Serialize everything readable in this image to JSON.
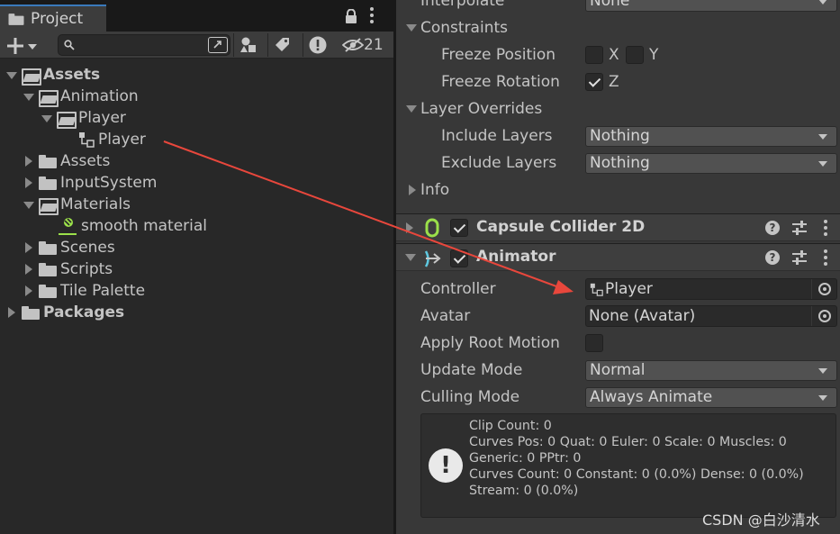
{
  "project": {
    "tab_label": "Project",
    "search": {
      "value": "",
      "placeholder": ""
    },
    "hidden_count": "21",
    "tree": [
      {
        "label": "Assets",
        "bold": true
      },
      {
        "label": "Animation"
      },
      {
        "label": "Player"
      },
      {
        "label": "Player"
      },
      {
        "label": "Assets"
      },
      {
        "label": "InputSystem"
      },
      {
        "label": "Materials"
      },
      {
        "label": "smooth material"
      },
      {
        "label": "Scenes"
      },
      {
        "label": "Scripts"
      },
      {
        "label": "Tile Palette"
      },
      {
        "label": "Packages",
        "bold": true
      }
    ]
  },
  "inspector": {
    "interpolate": {
      "label": "Interpolate",
      "value": "None"
    },
    "constraints": {
      "label": "Constraints"
    },
    "freeze_position": {
      "label": "Freeze Position",
      "x": "X",
      "y": "Y",
      "x_checked": false,
      "y_checked": false
    },
    "freeze_rotation": {
      "label": "Freeze Rotation",
      "z": "Z",
      "z_checked": true
    },
    "layer_overrides": {
      "label": "Layer Overrides"
    },
    "include_layers": {
      "label": "Include Layers",
      "value": "Nothing"
    },
    "exclude_layers": {
      "label": "Exclude Layers",
      "value": "Nothing"
    },
    "info": {
      "label": "Info"
    },
    "capsule": {
      "title": "Capsule Collider 2D",
      "help": "?"
    },
    "animator": {
      "title": "Animator",
      "help": "?",
      "controller": {
        "label": "Controller",
        "value": "Player"
      },
      "avatar": {
        "label": "Avatar",
        "value": "None (Avatar)"
      },
      "apply_root_motion": {
        "label": "Apply Root Motion",
        "checked": false
      },
      "update_mode": {
        "label": "Update Mode",
        "value": "Normal"
      },
      "culling_mode": {
        "label": "Culling Mode",
        "value": "Always Animate"
      },
      "info_lines": [
        "Clip Count: 0",
        "Curves Pos: 0 Quat: 0 Euler: 0 Scale: 0 Muscles: 0",
        "Generic: 0 PPtr: 0",
        "Curves Count: 0 Constant: 0 (0.0%) Dense: 0 (0.0%)",
        "Stream: 0 (0.0%)"
      ]
    }
  },
  "watermark": "CSDN @白沙清水",
  "colors": {
    "arrow": "#e8473c",
    "material_icon": "#9be04a",
    "capsule_icon": "#9be04a",
    "animator_icon": "#5ec8e0"
  }
}
